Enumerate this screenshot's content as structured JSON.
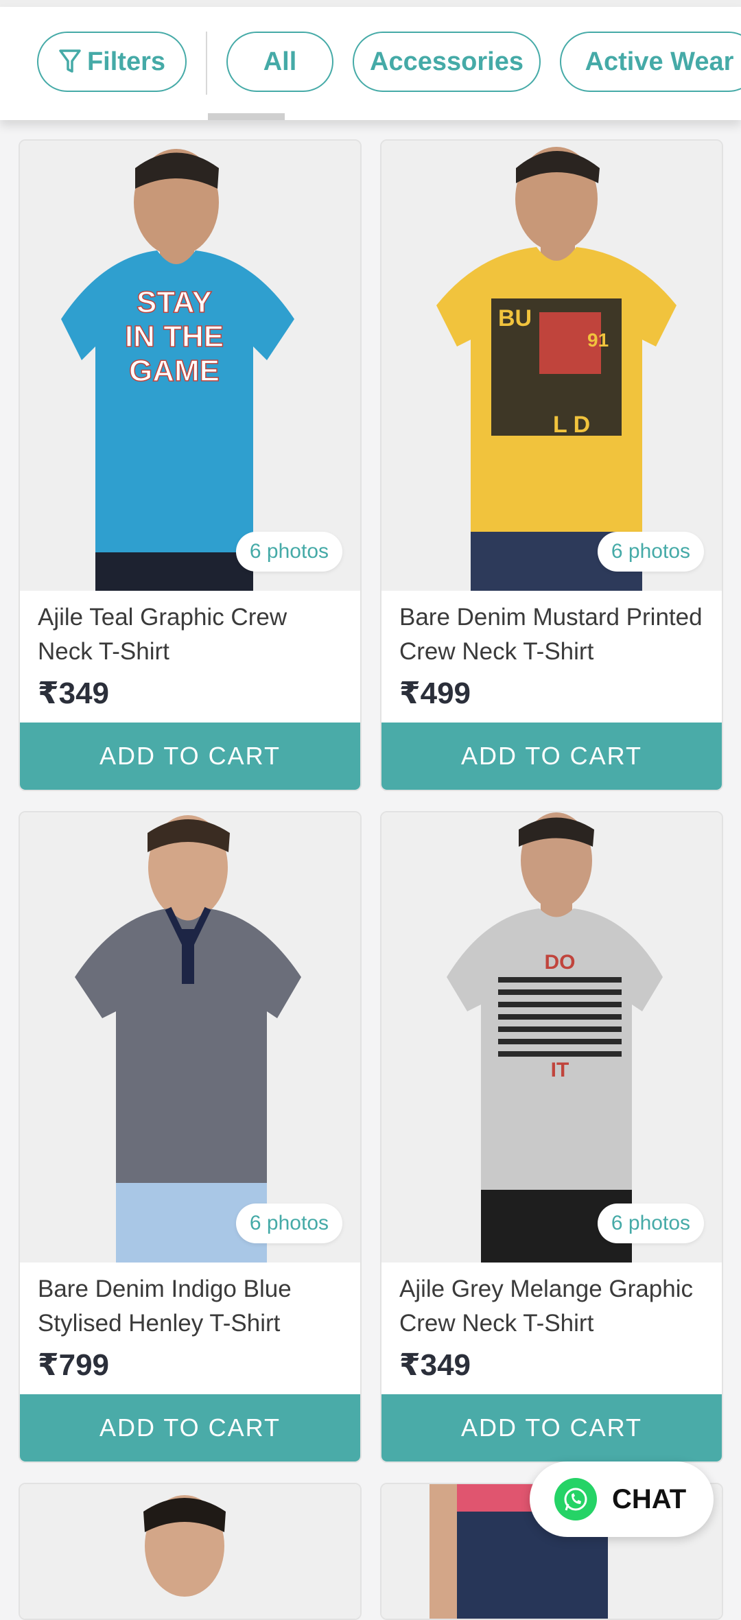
{
  "filter_bar": {
    "filters_label": "Filters",
    "categories": [
      {
        "label": "All"
      },
      {
        "label": "Accessories"
      },
      {
        "label": "Active Wear"
      }
    ]
  },
  "products": [
    {
      "title": "Ajile Teal Graphic Crew Neck T-Shirt",
      "price": "₹349",
      "photos": "6 photos",
      "cart_label": "ADD TO CART",
      "shirt_color": "#2f9fcf",
      "print_text": "STAY IN THE GAME"
    },
    {
      "title": "Bare Denim Mustard Printed Crew Neck T-Shirt",
      "price": "₹499",
      "photos": "6 photos",
      "cart_label": "ADD TO CART",
      "shirt_color": "#f1c33d",
      "print_text": "BU 91 LD"
    },
    {
      "title": "Bare Denim Indigo Blue Stylised Henley T-Shirt",
      "price": "₹799",
      "photos": "6 photos",
      "cart_label": "ADD TO CART",
      "shirt_color": "#6b6e7a",
      "print_text": ""
    },
    {
      "title": "Ajile Grey Melange Graphic Crew Neck T-Shirt",
      "price": "₹349",
      "photos": "6 photos",
      "cart_label": "ADD TO CART",
      "shirt_color": "#c9c9c9",
      "print_text": "DO IT"
    }
  ],
  "chat": {
    "label": "CHAT"
  },
  "colors": {
    "accent": "#45aaa7",
    "button": "#4aaba8",
    "price": "#2b2f3a"
  }
}
